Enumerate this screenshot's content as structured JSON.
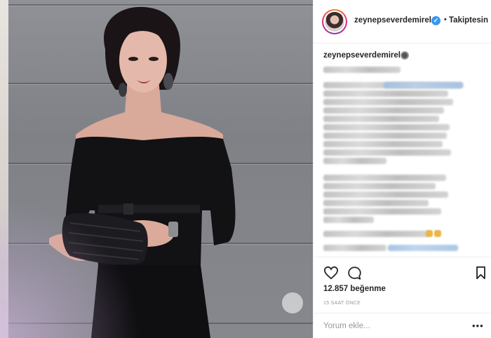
{
  "post": {
    "username": "zeynepseverdemirel",
    "follow_status": "Takiptesin",
    "separator": "•",
    "verified_mark": "✓",
    "likes": "12.857 beğenme",
    "time_ago": "15 SAAT ÖNCE",
    "comment_placeholder": "Yorum ekle...",
    "more_options": "•••"
  },
  "icons": {
    "like": "heart-icon",
    "comment": "comment-icon",
    "save": "bookmark-icon",
    "verified": "verified-badge-icon"
  },
  "colors": {
    "text": "#262626",
    "muted": "#999999",
    "verified": "#3897f0",
    "border": "#efefef"
  }
}
